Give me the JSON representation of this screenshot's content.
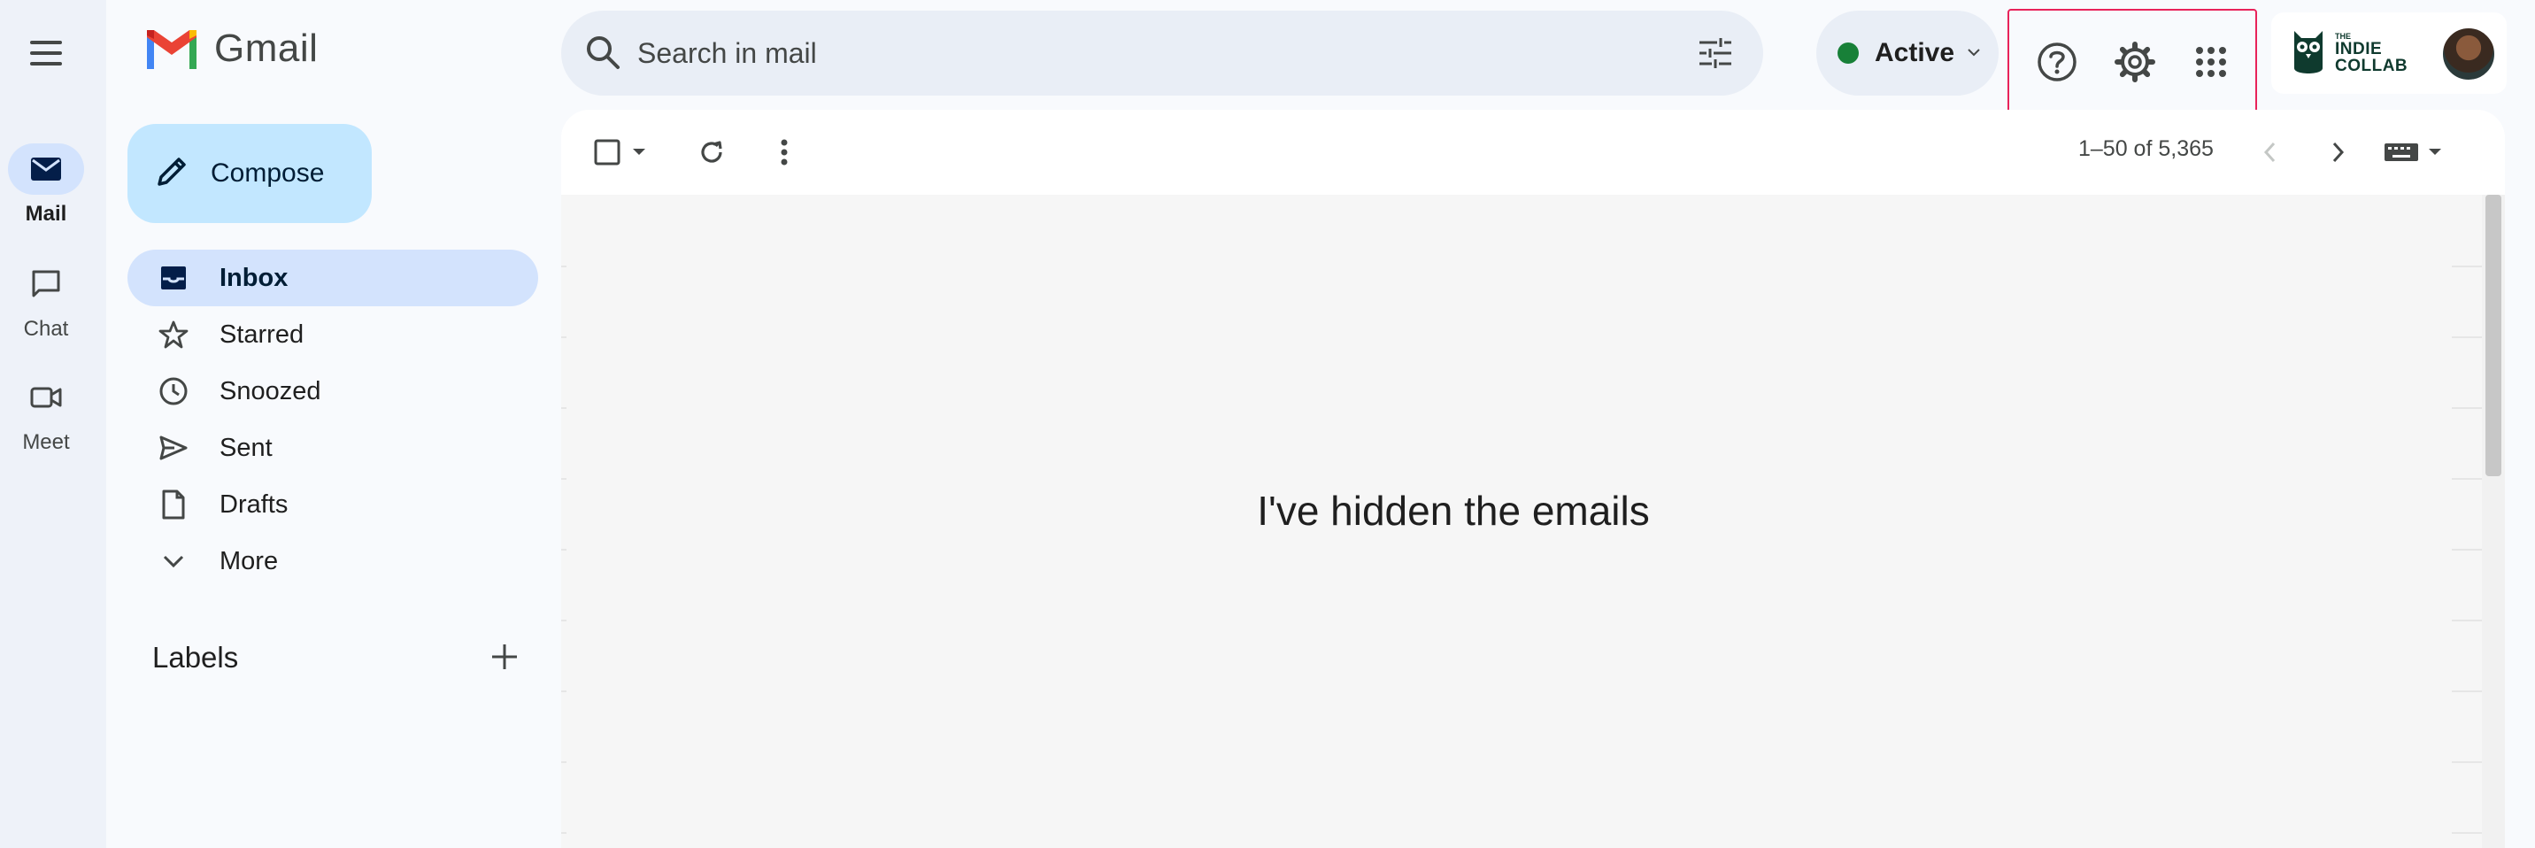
{
  "app": {
    "name": "Gmail"
  },
  "rail": {
    "items": [
      {
        "label": "Mail",
        "icon": "mail-icon",
        "active": true
      },
      {
        "label": "Chat",
        "icon": "chat-icon",
        "active": false
      },
      {
        "label": "Meet",
        "icon": "video-icon",
        "active": false
      }
    ]
  },
  "search": {
    "placeholder": "Search in mail"
  },
  "status": {
    "label": "Active",
    "color": "#188038"
  },
  "compose": {
    "label": "Compose"
  },
  "nav": {
    "items": [
      {
        "label": "Inbox",
        "icon": "inbox-icon",
        "active": true
      },
      {
        "label": "Starred",
        "icon": "star-icon"
      },
      {
        "label": "Snoozed",
        "icon": "clock-icon"
      },
      {
        "label": "Sent",
        "icon": "send-icon"
      },
      {
        "label": "Drafts",
        "icon": "draft-icon"
      },
      {
        "label": "More",
        "icon": "chevron-down-icon"
      }
    ]
  },
  "labels": {
    "title": "Labels"
  },
  "account": {
    "brand_small": "THE",
    "brand_line1": "INDIE",
    "brand_line2": "COLLAB"
  },
  "toolbar": {
    "page_info": "1–50 of 5,365"
  },
  "content": {
    "message": "I've hidden the emails"
  },
  "colors": {
    "accent": "#d3e3fd",
    "compose": "#c2e7ff",
    "highlight_border": "#e8225a"
  }
}
